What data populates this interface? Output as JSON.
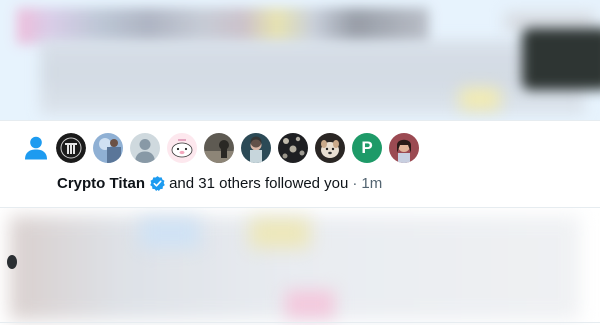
{
  "notification": {
    "type_icon": "person-icon",
    "avatars": [
      {
        "name": "avatar-pillar-logo",
        "kind": "logo"
      },
      {
        "name": "avatar-blue-photo",
        "kind": "photo"
      },
      {
        "name": "avatar-default-silhouette",
        "kind": "default"
      },
      {
        "name": "avatar-pink-cartoon",
        "kind": "cartoon"
      },
      {
        "name": "avatar-dark-photo",
        "kind": "photo"
      },
      {
        "name": "avatar-teal-photo",
        "kind": "photo"
      },
      {
        "name": "avatar-bokeh-photo",
        "kind": "photo"
      },
      {
        "name": "avatar-dog-photo",
        "kind": "photo"
      },
      {
        "name": "avatar-letter-p",
        "kind": "letter",
        "letter": "P"
      },
      {
        "name": "avatar-portrait-photo",
        "kind": "photo"
      }
    ],
    "user_name": "Crypto Titan",
    "verified_icon": "verified-badge-icon",
    "message_text": "and 31 others followed you",
    "separator": "·",
    "time": "1m"
  },
  "colors": {
    "accent": "#1d9bf0",
    "text": "#0f1419",
    "muted": "#536471",
    "highlight_bg": "#e7f3fd",
    "letter_avatar": "#1e9a68"
  }
}
